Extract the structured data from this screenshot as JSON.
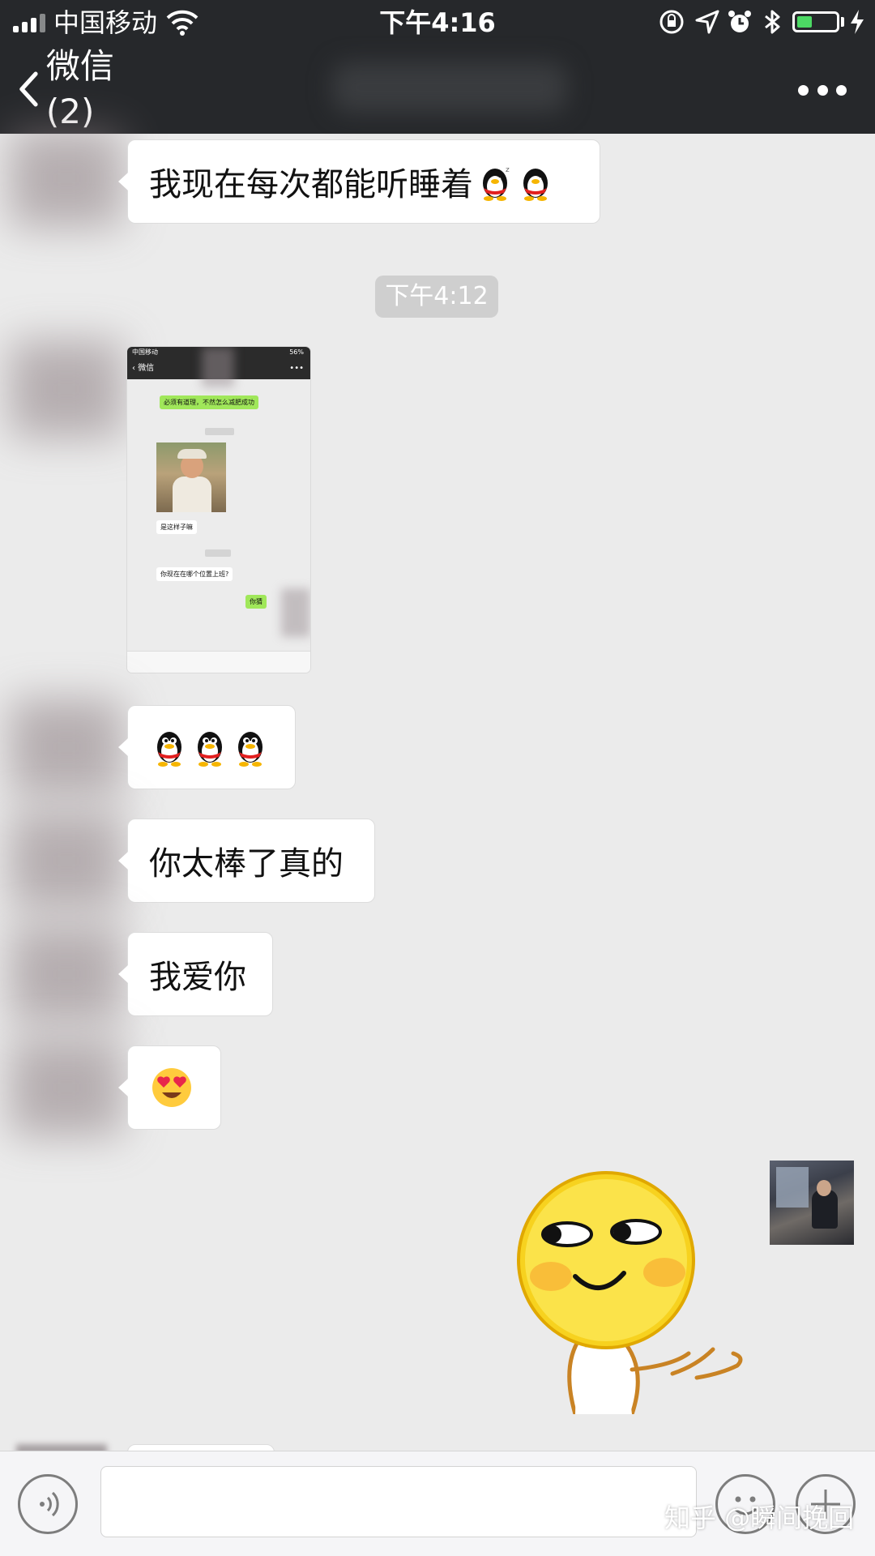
{
  "status_bar": {
    "carrier": "中国移动",
    "time": "下午4:16",
    "battery_level": 0.4
  },
  "nav": {
    "back_label": "微信(2)"
  },
  "messages": [
    {
      "text": "我现在每次都能听睡着",
      "emoji": "qq-penguin-sleepy x2"
    },
    {
      "timestamp": "下午4:12"
    },
    {
      "screenshot": {
        "carrier": "中国移动",
        "battery": "56%",
        "back_label": "微信",
        "msg1": "必须有道理，不然怎么减肥成功",
        "msg2": "是这样子嘛",
        "msg3": "你现在在哪个位置上班?",
        "msg4": "你猜"
      }
    },
    {
      "emoji": "qq-penguin x3"
    },
    {
      "text": "你太棒了真的"
    },
    {
      "text": "我爱你"
    },
    {
      "emoji": "heart-eyes-face"
    },
    {
      "sticker": "smirk-emoji-sticker"
    }
  ],
  "input_bar": {},
  "watermark": "知乎 @瞬间挽回"
}
